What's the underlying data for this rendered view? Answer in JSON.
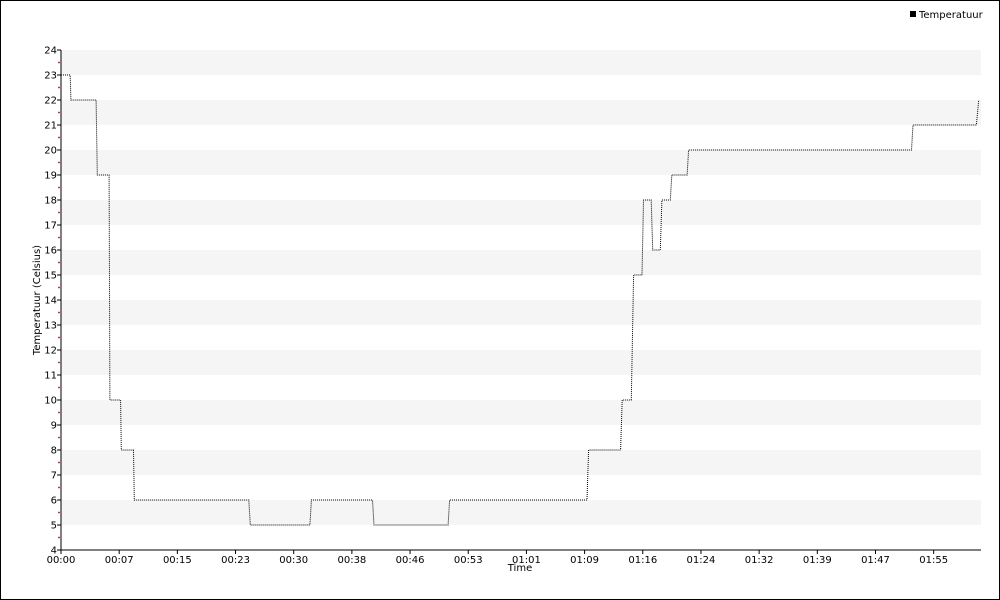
{
  "chart_data": {
    "type": "line",
    "xlabel": "Time",
    "ylabel": "Temperatuur (Celsius)",
    "ylim": [
      4,
      24
    ],
    "yticks": [
      4,
      5,
      6,
      7,
      8,
      9,
      10,
      11,
      12,
      13,
      14,
      15,
      16,
      17,
      18,
      19,
      20,
      21,
      22,
      23,
      24
    ],
    "x_tick_labels": [
      "00:00",
      "00:07",
      "00:15",
      "00:23",
      "00:30",
      "00:38",
      "00:46",
      "00:53",
      "01:01",
      "01:09",
      "01:16",
      "01:24",
      "01:32",
      "01:39",
      "01:47",
      "01:55"
    ],
    "x_tick_values_min": [
      0,
      7.62,
      15.24,
      22.86,
      30.48,
      38.1,
      45.72,
      53.34,
      60.96,
      68.58,
      76.2,
      83.82,
      91.44,
      99.06,
      106.68,
      114.3
    ],
    "xlim_min": [
      0,
      120.5
    ],
    "grid": "horizontal alternating bands",
    "legend": {
      "position": "top-right",
      "entries": [
        "Temperatuur"
      ]
    },
    "series": [
      {
        "name": "Temperatuur",
        "line_style": "dotted",
        "color": "#000000",
        "x_min": [
          0,
          1.2,
          1.3,
          4.6,
          4.75,
          6.3,
          6.4,
          7.8,
          7.9,
          9.5,
          9.6,
          24.6,
          24.8,
          32.6,
          32.8,
          40.8,
          41.0,
          50.7,
          50.9,
          68.9,
          69.1,
          73.3,
          73.5,
          74.7,
          75.0,
          76.1,
          76.3,
          77.3,
          77.5,
          78.5,
          78.7,
          79.8,
          80.0,
          80.8,
          81.0,
          82.0,
          82.2,
          85.2,
          85.4,
          111.4,
          111.6,
          119.9,
          120.2
        ],
        "y": [
          23,
          23,
          22,
          22,
          19,
          19,
          10,
          10,
          8,
          8,
          6,
          6,
          5,
          5,
          6,
          6,
          5,
          5,
          6,
          6,
          8,
          8,
          10,
          10,
          15,
          15,
          18,
          18,
          16,
          16,
          18,
          18,
          19,
          19,
          19,
          19,
          20,
          20,
          20,
          20,
          21,
          21,
          22
        ]
      }
    ]
  }
}
